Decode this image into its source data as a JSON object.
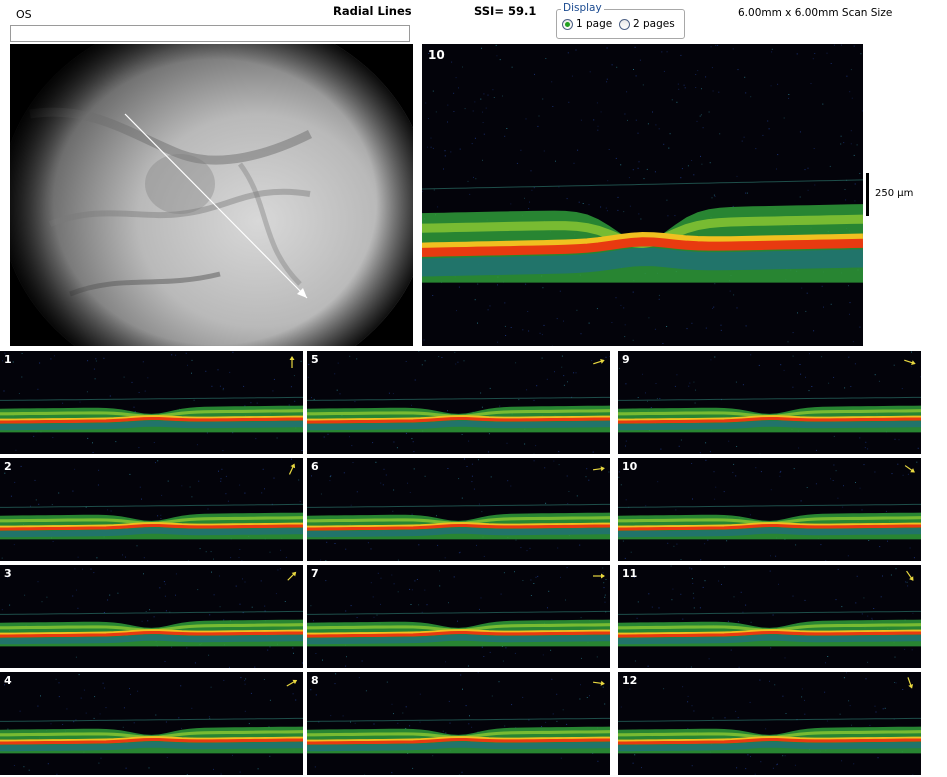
{
  "header": {
    "eye": "OS",
    "scan_type": "Radial Lines",
    "ssi": "SSI= 59.1",
    "scan_size": "6.00mm x 6.00mm Scan Size"
  },
  "display": {
    "legend": "Display",
    "options": [
      "1 page",
      "2 pages"
    ],
    "selected": "1 page"
  },
  "fundus": {
    "input_value": ""
  },
  "main_scan": {
    "number": "10",
    "scale_label": "250 µm"
  },
  "thumbnails": [
    {
      "number": "1",
      "arrow_dir": "up"
    },
    {
      "number": "2",
      "arrow_dir": "up-right-steep"
    },
    {
      "number": "3",
      "arrow_dir": "up-right"
    },
    {
      "number": "4",
      "arrow_dir": "up-right-shallow"
    },
    {
      "number": "5",
      "arrow_dir": "right-up"
    },
    {
      "number": "6",
      "arrow_dir": "right-up-slight"
    },
    {
      "number": "7",
      "arrow_dir": "right"
    },
    {
      "number": "8",
      "arrow_dir": "right-down-slight"
    },
    {
      "number": "9",
      "arrow_dir": "right-down"
    },
    {
      "number": "10",
      "arrow_dir": "down-right"
    },
    {
      "number": "11",
      "arrow_dir": "down-right-steep"
    },
    {
      "number": "12",
      "arrow_dir": "down"
    }
  ],
  "colors": {
    "arrow": "#e8d840",
    "layer_green": "#3cc23c",
    "layer_red": "#e83a10",
    "layer_yellow": "#f0d020"
  }
}
